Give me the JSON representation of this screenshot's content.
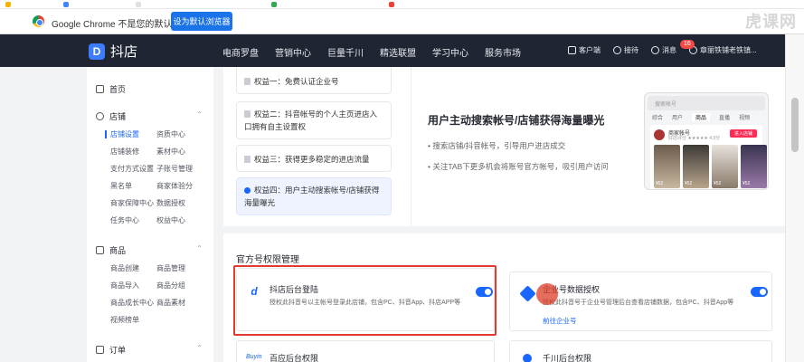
{
  "browser": {
    "infobar_message": "Google Chrome 不是您的默认浏览器",
    "infobar_button": "设为默认浏览器",
    "watermark": "虎课网"
  },
  "topnav": {
    "brand": "抖店",
    "links": [
      "电商罗盘",
      "营销中心",
      "巨量千川",
      "精选联盟",
      "学习中心",
      "服务市场"
    ],
    "customer_service": "客户端",
    "reception": "接待",
    "messages": "消息",
    "message_badge": "16",
    "account": "章丽铁铺老铁镇..."
  },
  "sidebar": {
    "home": "首页",
    "store": {
      "label": "店铺",
      "items": [
        [
          "店铺设置",
          "资质中心"
        ],
        [
          "店铺装修",
          "素材中心"
        ],
        [
          "支付方式设置",
          "子账号管理"
        ],
        [
          "黑名单",
          "商家体验分"
        ],
        [
          "商家保障中心",
          "数据授权"
        ],
        [
          "任务中心",
          "权益中心"
        ]
      ]
    },
    "goods": {
      "label": "商品",
      "items": [
        [
          "商品创建",
          "商品管理"
        ],
        [
          "商品导入",
          "商品分组"
        ],
        [
          "商品成长中心",
          "商品素材"
        ],
        [
          "视频榜单",
          ""
        ]
      ]
    },
    "orders": {
      "label": "订单"
    }
  },
  "benefits": {
    "cards": [
      "权益一：免费认证企业号",
      "权益二：抖音帐号的个人主页进店入口拥有自主设置权",
      "权益三：获得更多稳定的进店流量",
      "权益四：用户主动搜索帐号/店铺获得海量曝光"
    ],
    "feature_title": "用户主动搜索帐号/店铺获得海量曝光",
    "bullets": [
      "搜索店铺/抖音帐号，引导用户进店成交",
      "关注TAB下更多机会将账号官方帐号，吸引用户访问"
    ],
    "phone": {
      "search": "搜索帐号",
      "tabs": [
        "综合",
        "用户",
        "商品",
        "直播",
        "视频"
      ],
      "shop_name": "商家帐号",
      "shop_sub": "好店评分 ★★★★★ 4.9分",
      "enter_btn": "进入店铺",
      "prices": [
        "¥52",
        "¥52",
        "¥52",
        "¥52"
      ]
    }
  },
  "permissions": {
    "section_title": "官方号权限管理",
    "cards": [
      {
        "title": "抖店后台登陆",
        "desc": "授权此抖音号以主帐号登录此店铺，包含PC、抖音App、抖店APP等",
        "link": ""
      },
      {
        "title": "企业号数据授权",
        "desc": "授权此抖音号于企业号管理后台查看店铺数据，包含PC、抖音App等",
        "link": "前往企业号"
      },
      {
        "title": "百应后台权限",
        "desc": "",
        "link": ""
      },
      {
        "title": "千川后台权限",
        "desc": "",
        "link": ""
      }
    ],
    "buyin_logo": "Buyin"
  },
  "colors": {
    "accent": "#1966ff",
    "nav_bg": "#1f2533",
    "highlight": "#e23a2e"
  }
}
